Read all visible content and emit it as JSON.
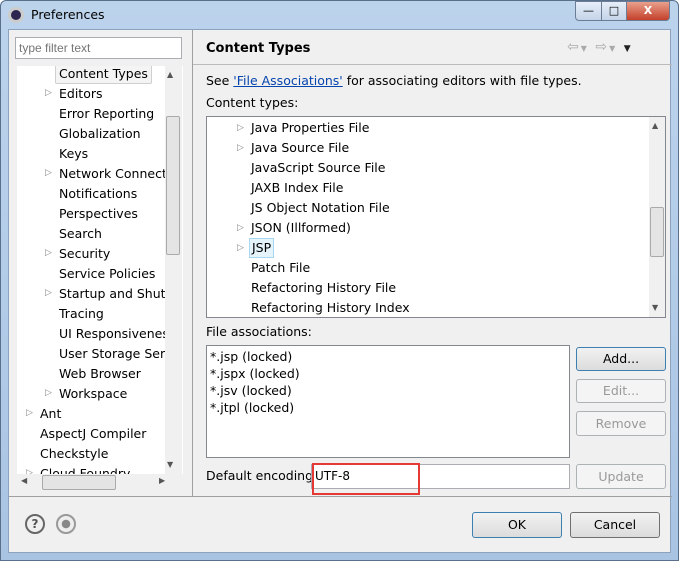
{
  "window": {
    "title": "Preferences",
    "min": "—",
    "max": "□",
    "close": "X"
  },
  "filter": {
    "placeholder": "type filter text"
  },
  "tree": {
    "items": [
      {
        "label": "Content Types",
        "expandable": false,
        "level": 2,
        "selected": true
      },
      {
        "label": "Editors",
        "expandable": true,
        "level": 2
      },
      {
        "label": "Error Reporting",
        "expandable": false,
        "level": 2
      },
      {
        "label": "Globalization",
        "expandable": false,
        "level": 2
      },
      {
        "label": "Keys",
        "expandable": false,
        "level": 2
      },
      {
        "label": "Network Connectio",
        "expandable": true,
        "level": 2
      },
      {
        "label": "Notifications",
        "expandable": false,
        "level": 2
      },
      {
        "label": "Perspectives",
        "expandable": false,
        "level": 2
      },
      {
        "label": "Search",
        "expandable": false,
        "level": 2
      },
      {
        "label": "Security",
        "expandable": true,
        "level": 2
      },
      {
        "label": "Service Policies",
        "expandable": false,
        "level": 2
      },
      {
        "label": "Startup and Shutd",
        "expandable": true,
        "level": 2
      },
      {
        "label": "Tracing",
        "expandable": false,
        "level": 2
      },
      {
        "label": "UI Responsiveness",
        "expandable": false,
        "level": 2
      },
      {
        "label": "User Storage Serv",
        "expandable": false,
        "level": 2
      },
      {
        "label": "Web Browser",
        "expandable": false,
        "level": 2
      },
      {
        "label": "Workspace",
        "expandable": true,
        "level": 2
      },
      {
        "label": "Ant",
        "expandable": true,
        "level": 1
      },
      {
        "label": "AspectJ Compiler",
        "expandable": false,
        "level": 1
      },
      {
        "label": "Checkstyle",
        "expandable": false,
        "level": 1
      },
      {
        "label": "Cloud Foundry",
        "expandable": true,
        "level": 1
      }
    ]
  },
  "page": {
    "title": "Content Types",
    "see_prefix": "See ",
    "link": "'File Associations'",
    "see_suffix": " for associating editors with file types.",
    "content_types_label": "Content types:"
  },
  "content_types": [
    {
      "label": "Java Properties File",
      "expandable": true
    },
    {
      "label": "Java Source File",
      "expandable": true
    },
    {
      "label": "JavaScript Source File",
      "expandable": false
    },
    {
      "label": "JAXB Index File",
      "expandable": false
    },
    {
      "label": "JS Object Notation File",
      "expandable": false
    },
    {
      "label": "JSON (Illformed)",
      "expandable": true
    },
    {
      "label": "JSP",
      "expandable": true,
      "selected": true
    },
    {
      "label": "Patch File",
      "expandable": false
    },
    {
      "label": "Refactoring History File",
      "expandable": false
    },
    {
      "label": "Refactoring History Index",
      "expandable": false
    }
  ],
  "file_assoc": {
    "label": "File associations:",
    "items": [
      "*.jsp (locked)",
      "*.jspx (locked)",
      "*.jsv (locked)",
      "*.jtpl (locked)"
    ],
    "add": "Add...",
    "edit": "Edit...",
    "remove": "Remove"
  },
  "encoding": {
    "label": "Default encoding:",
    "value": "UTF-8",
    "update": "Update",
    "highlight_color": "#e53935"
  },
  "footer": {
    "ok": "OK",
    "cancel": "Cancel",
    "help": "?"
  }
}
